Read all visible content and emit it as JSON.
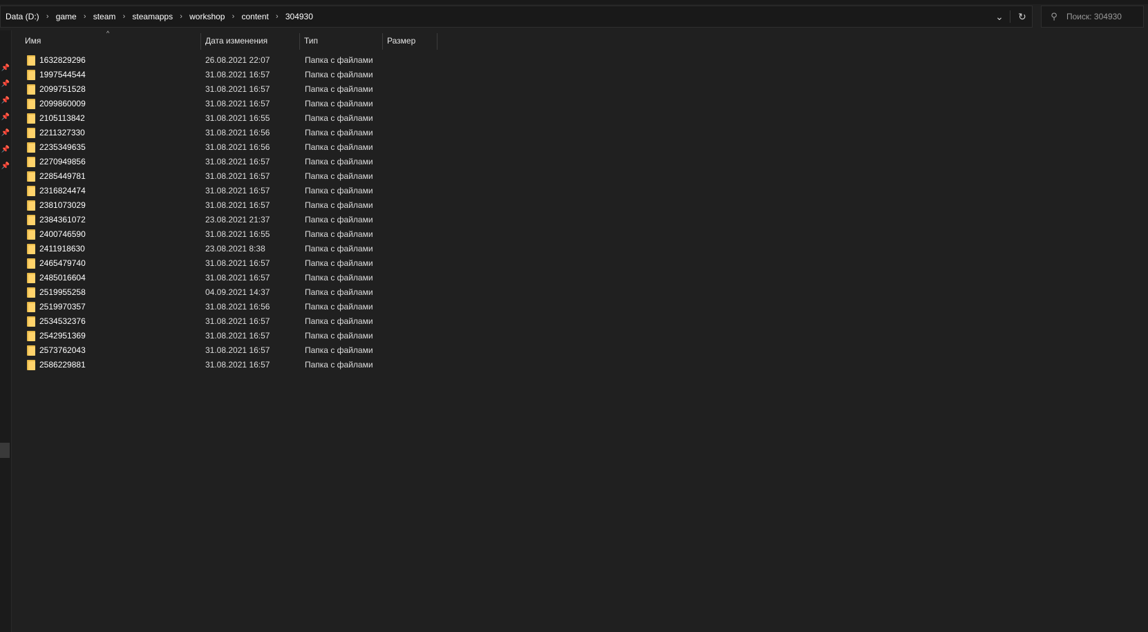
{
  "breadcrumb": [
    "Data (D:)",
    "game",
    "steam",
    "steamapps",
    "workshop",
    "content",
    "304930"
  ],
  "search": {
    "placeholder": "Поиск: 304930"
  },
  "columns": {
    "name": "Имя",
    "date": "Дата изменения",
    "type": "Тип",
    "size": "Размер"
  },
  "files": [
    {
      "name": "1632829296",
      "date": "26.08.2021 22:07",
      "type": "Папка с файлами"
    },
    {
      "name": "1997544544",
      "date": "31.08.2021 16:57",
      "type": "Папка с файлами"
    },
    {
      "name": "2099751528",
      "date": "31.08.2021 16:57",
      "type": "Папка с файлами"
    },
    {
      "name": "2099860009",
      "date": "31.08.2021 16:57",
      "type": "Папка с файлами"
    },
    {
      "name": "2105113842",
      "date": "31.08.2021 16:55",
      "type": "Папка с файлами"
    },
    {
      "name": "2211327330",
      "date": "31.08.2021 16:56",
      "type": "Папка с файлами"
    },
    {
      "name": "2235349635",
      "date": "31.08.2021 16:56",
      "type": "Папка с файлами"
    },
    {
      "name": "2270949856",
      "date": "31.08.2021 16:57",
      "type": "Папка с файлами"
    },
    {
      "name": "2285449781",
      "date": "31.08.2021 16:57",
      "type": "Папка с файлами"
    },
    {
      "name": "2316824474",
      "date": "31.08.2021 16:57",
      "type": "Папка с файлами"
    },
    {
      "name": "2381073029",
      "date": "31.08.2021 16:57",
      "type": "Папка с файлами"
    },
    {
      "name": "2384361072",
      "date": "23.08.2021 21:37",
      "type": "Папка с файлами"
    },
    {
      "name": "2400746590",
      "date": "31.08.2021 16:55",
      "type": "Папка с файлами"
    },
    {
      "name": "2411918630",
      "date": "23.08.2021 8:38",
      "type": "Папка с файлами"
    },
    {
      "name": "2465479740",
      "date": "31.08.2021 16:57",
      "type": "Папка с файлами"
    },
    {
      "name": "2485016604",
      "date": "31.08.2021 16:57",
      "type": "Папка с файлами"
    },
    {
      "name": "2519955258",
      "date": "04.09.2021 14:37",
      "type": "Папка с файлами"
    },
    {
      "name": "2519970357",
      "date": "31.08.2021 16:56",
      "type": "Папка с файлами"
    },
    {
      "name": "2534532376",
      "date": "31.08.2021 16:57",
      "type": "Папка с файлами"
    },
    {
      "name": "2542951369",
      "date": "31.08.2021 16:57",
      "type": "Папка с файлами"
    },
    {
      "name": "2573762043",
      "date": "31.08.2021 16:57",
      "type": "Папка с файлами"
    },
    {
      "name": "2586229881",
      "date": "31.08.2021 16:57",
      "type": "Папка с файлами"
    }
  ]
}
